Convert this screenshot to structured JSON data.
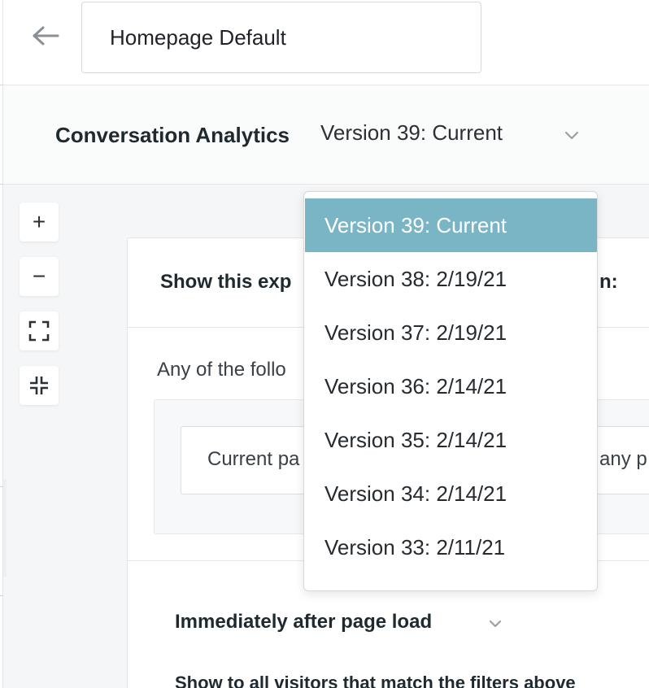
{
  "header": {
    "experience_name": "Homepage Default"
  },
  "subheader": {
    "title": "Conversation Analytics",
    "selected_version": "Version 39: Current"
  },
  "zoom_controls": {
    "zoom_in": "+",
    "zoom_out": "−"
  },
  "card": {
    "heading_visible": "Show this exp",
    "heading_tail": "n:",
    "any_label": "Any of the follo",
    "filter_row_text": "Current pa",
    "filter_row_tail": "any p",
    "timing_label": "Immediately after page load",
    "show_all_text": "Show to all visitors that match the filters above"
  },
  "version_dropdown": {
    "items": [
      {
        "label": "Version 39: Current",
        "selected": true
      },
      {
        "label": "Version 38: 2/19/21",
        "selected": false
      },
      {
        "label": "Version 37: 2/19/21",
        "selected": false
      },
      {
        "label": "Version 36: 2/14/21",
        "selected": false
      },
      {
        "label": "Version 35: 2/14/21",
        "selected": false
      },
      {
        "label": "Version 34: 2/14/21",
        "selected": false
      },
      {
        "label": "Version 33: 2/11/21",
        "selected": false
      }
    ]
  },
  "colors": {
    "accent_selected": "#79b5c4",
    "icon_gray": "#8a9096"
  }
}
